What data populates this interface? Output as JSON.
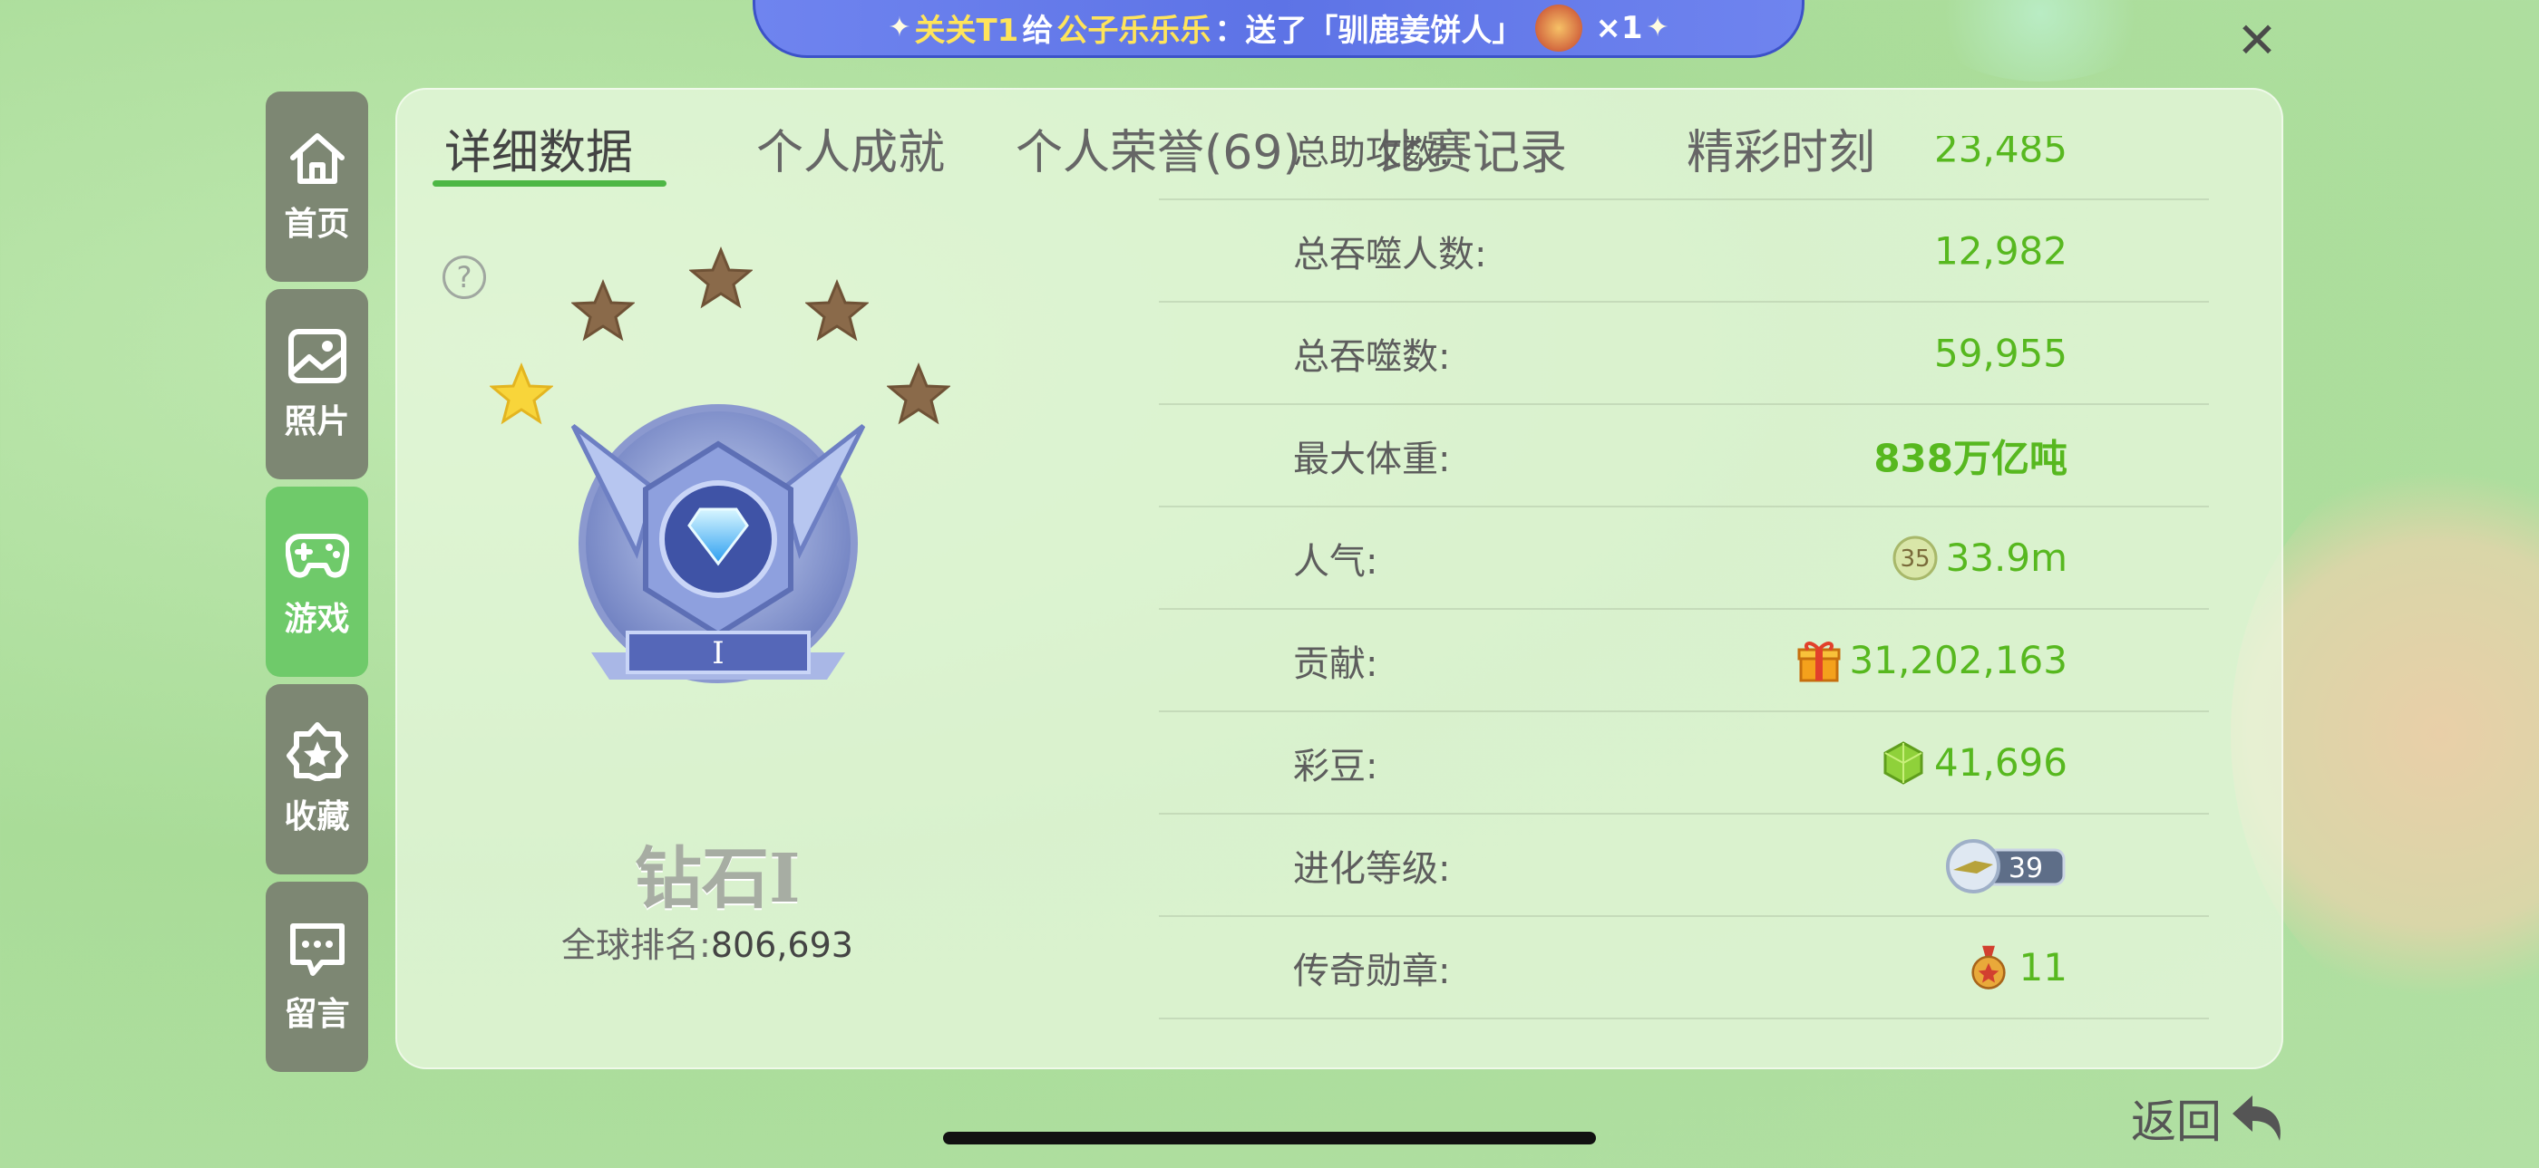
{
  "banner": {
    "sender": "关关T1",
    "verb": "给",
    "receiver": "公子乐乐乐",
    "action": "：送了「驯鹿姜饼人」",
    "count": "×1"
  },
  "sidebar": {
    "items": [
      {
        "label": "首页",
        "icon": "home-icon"
      },
      {
        "label": "照片",
        "icon": "photo-icon"
      },
      {
        "label": "游戏",
        "icon": "gamepad-icon",
        "active": true
      },
      {
        "label": "收藏",
        "icon": "star-badge-icon"
      },
      {
        "label": "留言",
        "icon": "message-icon"
      }
    ]
  },
  "tabs": [
    {
      "label": "详细数据",
      "active": true
    },
    {
      "label": "个人成就"
    },
    {
      "label": "个人荣誉(69)"
    },
    {
      "label": "比赛记录"
    },
    {
      "label": "精彩时刻"
    }
  ],
  "rank": {
    "name": "钻石Ⅰ",
    "badge_numeral": "Ⅰ",
    "stars_filled": 1,
    "stars_total": 5,
    "global_rank_label": "全球排名:",
    "global_rank_value": "806,693"
  },
  "stats": [
    {
      "label": "总助攻数:",
      "value": "23,485"
    },
    {
      "label": "总吞噬人数:",
      "value": "12,982"
    },
    {
      "label": "总吞噬数:",
      "value": "59,955"
    },
    {
      "label": "最大体重:",
      "value": "838万亿吨"
    },
    {
      "label": "人气:",
      "value": "33.9m",
      "icon": "popularity-level-icon",
      "icon_text": "35"
    },
    {
      "label": "贡献:",
      "value": "31,202,163",
      "icon": "gift-icon"
    },
    {
      "label": "彩豆:",
      "value": "41,696",
      "icon": "green-bean-icon"
    },
    {
      "label": "进化等级:",
      "value": "",
      "icon": "evolution-badge-icon",
      "icon_text": "39"
    },
    {
      "label": "传奇勋章:",
      "value": "11",
      "icon": "legend-medal-icon"
    }
  ],
  "footer": {
    "back_label": "返回"
  },
  "colors": {
    "accent_green": "#4db745",
    "value_green": "#57b81f",
    "sidebar_bg": "#7d8773",
    "sidebar_active": "#6fca6a",
    "star_filled": "#f8d53a",
    "star_empty": "#8a6a4a"
  }
}
